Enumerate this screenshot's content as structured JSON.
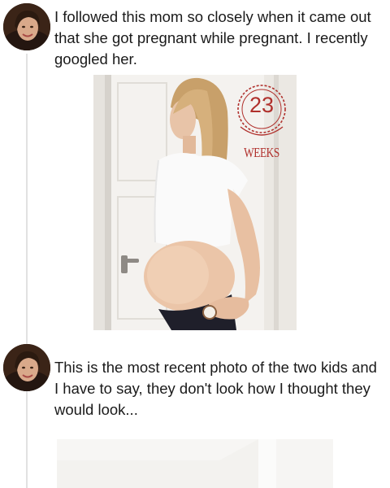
{
  "posts": [
    {
      "text": "I followed this mom so closely when it came out that she got pregnant while pregnant. I recently googled her.",
      "image": {
        "badge_number": "23",
        "badge_label": "WEEKS"
      }
    },
    {
      "text": "This is the most recent photo of the two kids and I have to say, they don't look how I thought they would look..."
    }
  ]
}
